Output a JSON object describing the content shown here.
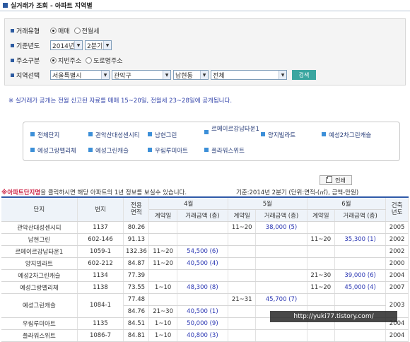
{
  "title": "실거래가 조회 - 아파트 지역별",
  "form": {
    "trade_type_label": "거래유형",
    "trade_options": [
      "매매",
      "전월세"
    ],
    "year_label": "기준년도",
    "year_value": "2014년",
    "quarter_value": "2분기",
    "address_label": "주소구분",
    "address_options": [
      "지번주소",
      "도로명주소"
    ],
    "region_label": "지역선택",
    "region_sido": "서울특별시",
    "region_gu": "관악구",
    "region_dong": "남현동",
    "region_all": "전체",
    "search_label": "검색"
  },
  "notice": "※ 실거래가 공개는 전월 신고된 자료를 매매 15~20일, 전월세 23~28일에 공개됩니다.",
  "apartments": [
    "전체단지",
    "관악산대성센시티",
    "남현그린",
    "르메이르강남타운1",
    "양지빌라트",
    "예성2차그린캐슬",
    "예성그랑펠리체",
    "예성그린캐슬",
    "우림루미아트",
    "플라워스위트"
  ],
  "print_label": "인쇄",
  "instr": {
    "highlight": "※아파트단지명",
    "rest": "을 클릭하시면 해당 아파트의 1년 정보를 보실수 있습니다."
  },
  "basis": "기준:2014년 2분기   (단위:면적-(㎡), 금액-만원)",
  "table": {
    "h_complex": "단지",
    "h_lot": "번지",
    "h_area": "전용면적",
    "h_built": "건축년도",
    "months": [
      "4월",
      "5월",
      "6월"
    ],
    "sub_contract": "계약일",
    "sub_price": "거래금액 (층)",
    "rows": [
      {
        "name": "관악산대성센시티",
        "lot": "1137",
        "area": "80.26",
        "m4d": "",
        "m4p": "",
        "m4f": "",
        "m5d": "11~20",
        "m5p": "38,000",
        "m5f": "(5)",
        "m6d": "",
        "m6p": "",
        "m6f": "",
        "year": "2005"
      },
      {
        "name": "남현그린",
        "lot": "602-146",
        "area": "91.13",
        "m4d": "",
        "m4p": "",
        "m4f": "",
        "m5d": "",
        "m5p": "",
        "m5f": "",
        "m6d": "11~20",
        "m6p": "35,300",
        "m6f": "(1)",
        "year": "2002"
      },
      {
        "name": "르메이르강남타운1",
        "lot": "1059-1",
        "area": "132.36",
        "m4d": "11~20",
        "m4p": "54,500",
        "m4f": "(6)",
        "m5d": "",
        "m5p": "",
        "m5f": "",
        "m6d": "",
        "m6p": "",
        "m6f": "",
        "year": "2002"
      },
      {
        "name": "양지빌라트",
        "lot": "602-212",
        "area": "84.87",
        "m4d": "11~20",
        "m4p": "40,500",
        "m4f": "(4)",
        "m5d": "",
        "m5p": "",
        "m5f": "",
        "m6d": "",
        "m6p": "",
        "m6f": "",
        "year": "2000"
      },
      {
        "name": "예성2차그린캐슬",
        "lot": "1134",
        "area": "77.39",
        "m4d": "",
        "m4p": "",
        "m4f": "",
        "m5d": "",
        "m5p": "",
        "m5f": "",
        "m6d": "21~30",
        "m6p": "39,000",
        "m6f": "(6)",
        "year": "2004"
      },
      {
        "name": "예성그랑펠리체",
        "lot": "1138",
        "area": "73.55",
        "m4d": "1~10",
        "m4p": "48,300",
        "m4f": "(8)",
        "m5d": "",
        "m5p": "",
        "m5f": "",
        "m6d": "11~20",
        "m6p": "45,000",
        "m6f": "(4)",
        "year": "2007"
      }
    ],
    "multi": {
      "name": "예성그린캐슬",
      "lot": "1084-1",
      "year": "2003",
      "sub": [
        {
          "area": "77.48",
          "m4d": "",
          "m4p": "",
          "m4f": "",
          "m5d": "21~31",
          "m5p": "45,700",
          "m5f": "(7)",
          "m6d": "",
          "m6p": "",
          "m6f": ""
        },
        {
          "area": "84.76",
          "m4d": "21~30",
          "m4p": "40,500",
          "m4f": "(1)",
          "m5d": "",
          "m5p": "",
          "m5f": "",
          "m6d": "",
          "m6p": "",
          "m6f": ""
        }
      ]
    },
    "tail": [
      {
        "name": "우림루미아트",
        "lot": "1135",
        "area": "84.51",
        "m4d": "1~10",
        "m4p": "50,000",
        "m4f": "(9)",
        "m5d": "",
        "m5p": "",
        "m5f": "",
        "m6d": "",
        "m6p": "",
        "m6f": "",
        "year": "2004"
      },
      {
        "name": "플라워스위트",
        "lot": "1086-7",
        "area": "84.81",
        "m4d": "1~10",
        "m4p": "40,800",
        "m4f": "(3)",
        "m5d": "",
        "m5p": "",
        "m5f": "",
        "m6d": "",
        "m6p": "",
        "m6f": "",
        "year": "2004"
      }
    ]
  },
  "watermark": "http://yuki77.tistory.com/"
}
